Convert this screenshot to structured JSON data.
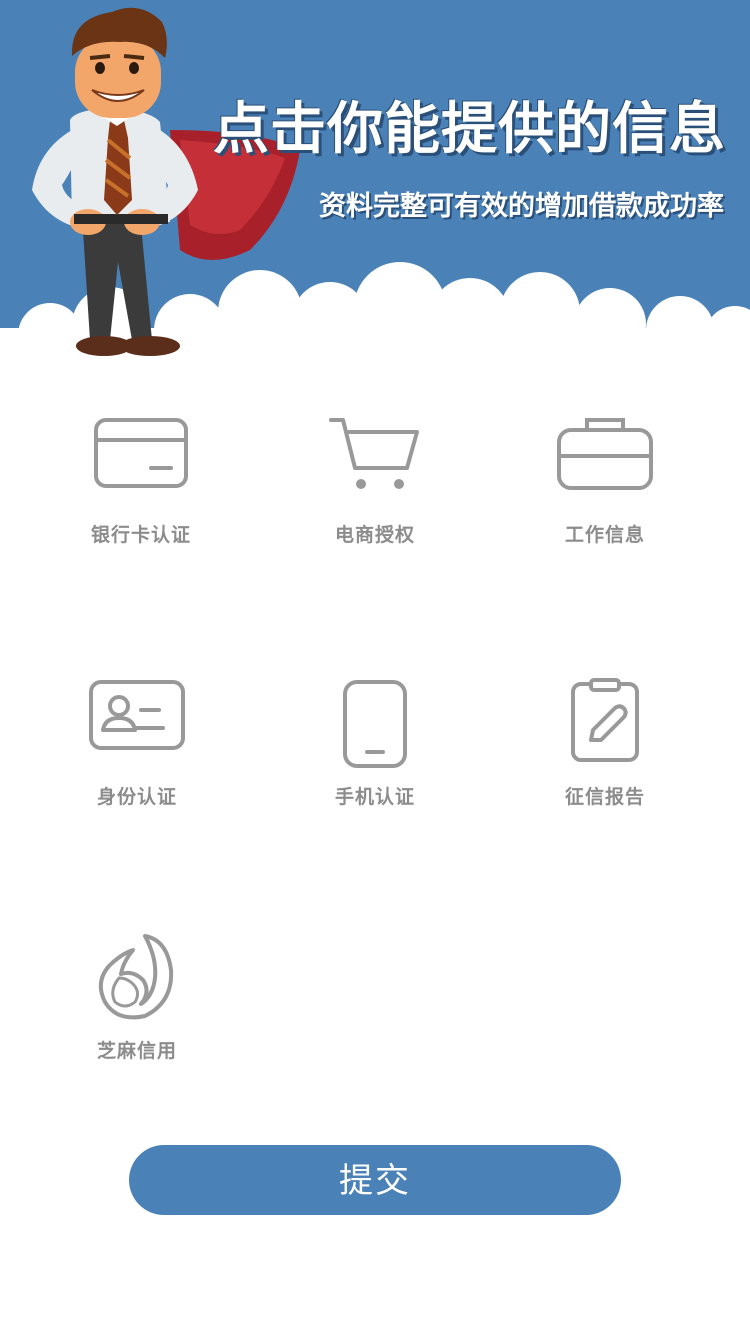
{
  "banner": {
    "headline": "点击你能提供的信息",
    "subline": "资料完整可有效的增加借款成功率",
    "colors": {
      "background": "#4a82b7",
      "cloud": "#ffffff"
    },
    "mascot_icon": "superhero-businessman-illustration"
  },
  "items": [
    {
      "label": "银行卡认证",
      "icon": "credit-card-icon"
    },
    {
      "label": "电商授权",
      "icon": "shopping-cart-icon"
    },
    {
      "label": "工作信息",
      "icon": "briefcase-icon"
    },
    {
      "label": "身份认证",
      "icon": "id-card-icon"
    },
    {
      "label": "手机认证",
      "icon": "mobile-phone-icon"
    },
    {
      "label": "征信报告",
      "icon": "clipboard-pencil-icon"
    },
    {
      "label": "芝麻信用",
      "icon": "sesame-credit-icon"
    }
  ],
  "submit": {
    "label": "提交",
    "color": "#4a82b7"
  },
  "icon_color": "#999999"
}
